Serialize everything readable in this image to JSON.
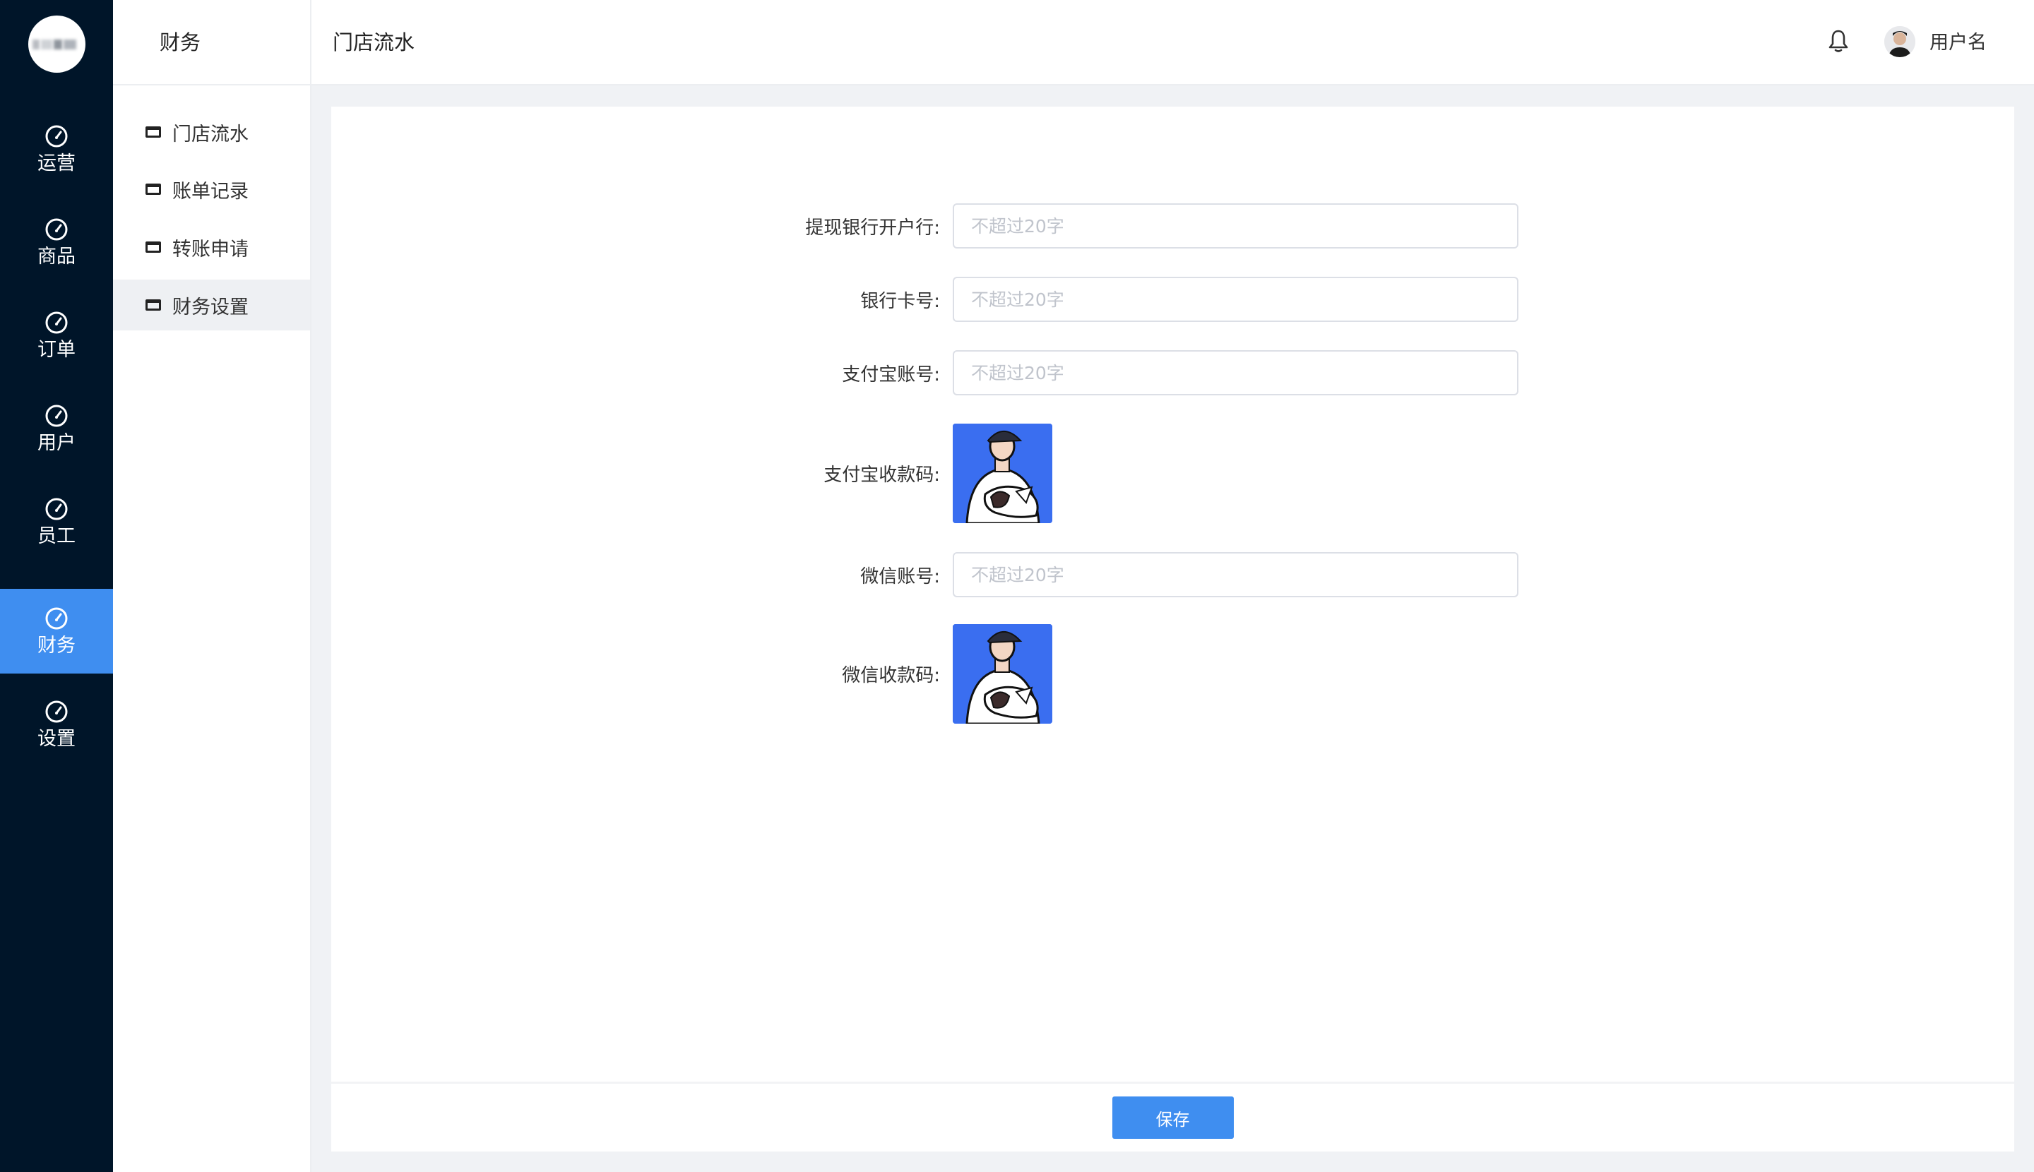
{
  "colors": {
    "rail_bg": "#001529",
    "accent": "#3f8ef0",
    "qr_bg": "#3a6ef0",
    "page_bg": "#f0f2f5"
  },
  "rail": {
    "logo_icon": "blurred-logo",
    "items": [
      {
        "label": "运营",
        "icon": "dashboard-icon",
        "active": false
      },
      {
        "label": "商品",
        "icon": "dashboard-icon",
        "active": false
      },
      {
        "label": "订单",
        "icon": "dashboard-icon",
        "active": false
      },
      {
        "label": "用户",
        "icon": "dashboard-icon",
        "active": false
      },
      {
        "label": "员工",
        "icon": "dashboard-icon",
        "active": false
      },
      {
        "label": "财务",
        "icon": "dashboard-icon",
        "active": true
      },
      {
        "label": "设置",
        "icon": "dashboard-icon",
        "active": false
      }
    ]
  },
  "subnav": {
    "title": "财务",
    "items": [
      {
        "label": "门店流水",
        "icon": "window-icon",
        "active": false
      },
      {
        "label": "账单记录",
        "icon": "window-icon",
        "active": false
      },
      {
        "label": "转账申请",
        "icon": "window-icon",
        "active": false
      },
      {
        "label": "财务设置",
        "icon": "window-icon",
        "active": true
      }
    ]
  },
  "header": {
    "title": "门店流水",
    "bell_icon": "bell-icon",
    "username": "用户名"
  },
  "form": {
    "bank": {
      "label": "提现银行开户行:",
      "value": "",
      "placeholder": "不超过20字"
    },
    "card_no": {
      "label": "银行卡号:",
      "value": "",
      "placeholder": "不超过20字"
    },
    "alipay_account": {
      "label": "支付宝账号:",
      "value": "",
      "placeholder": "不超过20字"
    },
    "alipay_qr": {
      "label": "支付宝收款码:",
      "icon": "qr-code-image"
    },
    "wechat_account": {
      "label": "微信账号:",
      "value": "",
      "placeholder": "不超过20字"
    },
    "wechat_qr": {
      "label": "微信收款码:",
      "icon": "qr-code-image"
    }
  },
  "footer": {
    "save_label": "保存"
  }
}
